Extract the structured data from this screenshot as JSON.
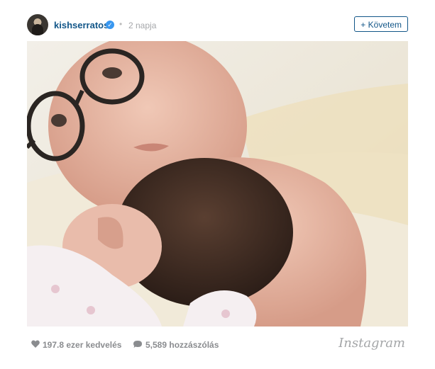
{
  "post": {
    "username": "kishserratos",
    "verified": true,
    "separator": "•",
    "time_ago": "2 napja",
    "follow_label": "+ Követem"
  },
  "photo": {
    "description_colors": {
      "background": "#e6e2da",
      "skin": "#e3b3a2",
      "hair": "#3e2b22",
      "onesie": "#f4eef1"
    }
  },
  "footer": {
    "likes": "197.8 ezer kedvelés",
    "comments": "5,589 hozzászólás",
    "brand": "Instagram"
  },
  "icons": {
    "avatar": "avatar",
    "verified": "verified-badge-icon",
    "heart": "heart-icon",
    "comment": "comment-icon"
  }
}
